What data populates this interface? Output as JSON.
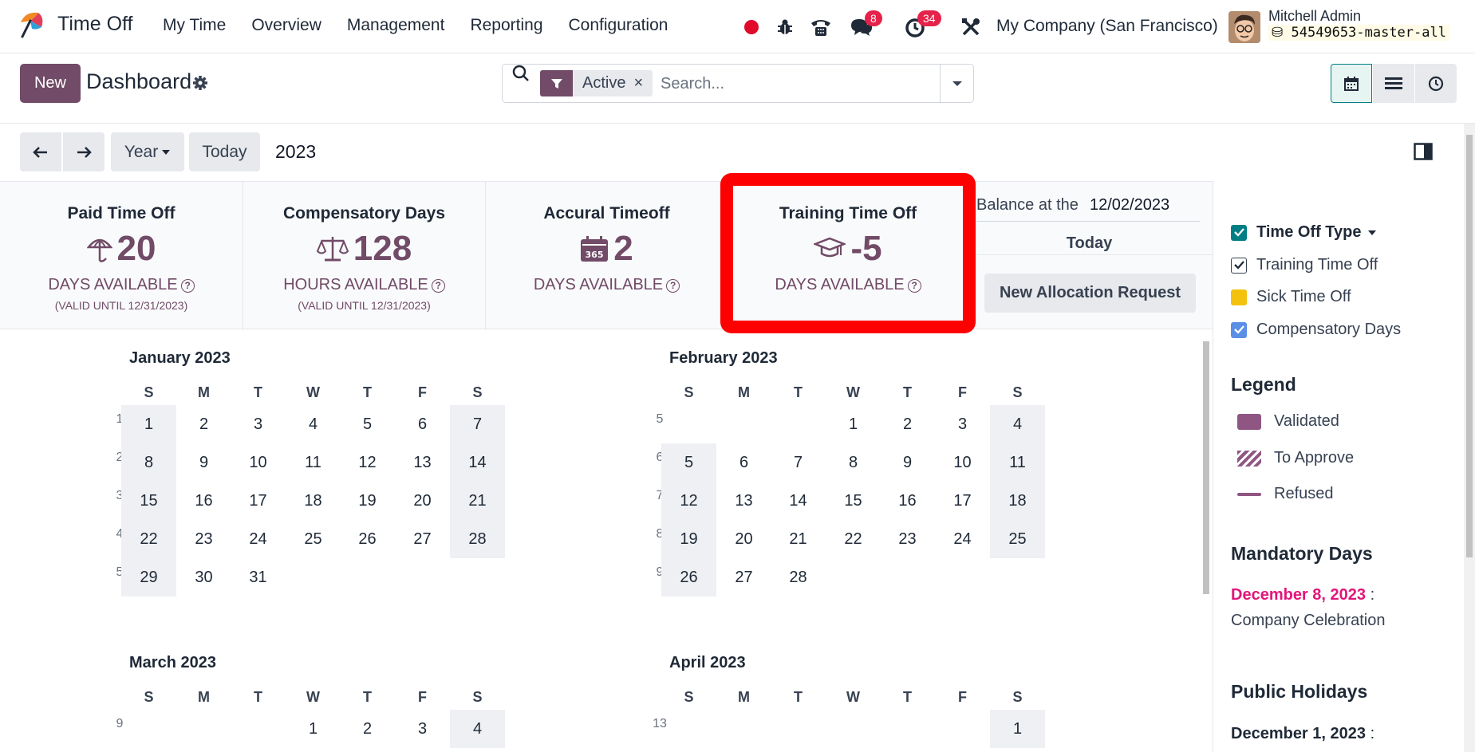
{
  "app": {
    "name": "Time Off",
    "menu": [
      "My Time",
      "Overview",
      "Management",
      "Reporting",
      "Configuration"
    ],
    "messages_count": "8",
    "activities_count": "34",
    "company": "My Company (San Francisco)",
    "user_name": "Mitchell Admin",
    "db_name": "54549653-master-all"
  },
  "control_panel": {
    "new_label": "New",
    "title": "Dashboard",
    "facet_label": "Active",
    "facet_remove": "×",
    "search_placeholder": "Search..."
  },
  "toolbar": {
    "scale_label": "Year",
    "today_label": "Today",
    "current_period": "2023"
  },
  "summary": {
    "cards": [
      {
        "title": "Paid Time Off",
        "value": "20",
        "unit": "DAYS AVAILABLE",
        "valid": "(VALID UNTIL 12/31/2023)",
        "icon": "beach-umbrella-icon"
      },
      {
        "title": "Compensatory Days",
        "value": "128",
        "unit": "HOURS AVAILABLE",
        "valid": "(VALID UNTIL 12/31/2023)",
        "icon": "balance-scale-icon"
      },
      {
        "title": "Accural Timeoff",
        "value": "2",
        "unit": "DAYS AVAILABLE",
        "valid": "",
        "icon": "calendar-365-icon"
      },
      {
        "title": "Training Time Off",
        "value": "-5",
        "unit": "DAYS AVAILABLE",
        "valid": "",
        "icon": "graduation-cap-icon"
      }
    ],
    "help_glyph": "?",
    "balance_label": "Balance at the",
    "balance_date": "12/02/2023",
    "balance_mode": "Today",
    "allocation_button": "New Allocation Request",
    "highlight_color": "#ff0000"
  },
  "calendar": {
    "weekdays": [
      "S",
      "M",
      "T",
      "W",
      "T",
      "F",
      "S"
    ],
    "months": [
      {
        "title": "January 2023",
        "weeks": [
          {
            "wk": "1",
            "days": [
              "1",
              "2",
              "3",
              "4",
              "5",
              "6",
              "7"
            ]
          },
          {
            "wk": "2",
            "days": [
              "8",
              "9",
              "10",
              "11",
              "12",
              "13",
              "14"
            ]
          },
          {
            "wk": "3",
            "days": [
              "15",
              "16",
              "17",
              "18",
              "19",
              "20",
              "21"
            ]
          },
          {
            "wk": "4",
            "days": [
              "22",
              "23",
              "24",
              "25",
              "26",
              "27",
              "28"
            ]
          },
          {
            "wk": "5",
            "days": [
              "29",
              "30",
              "31",
              "",
              "",
              "",
              ""
            ]
          }
        ]
      },
      {
        "title": "February 2023",
        "weeks": [
          {
            "wk": "5",
            "days": [
              "",
              "",
              "",
              "1",
              "2",
              "3",
              "4"
            ]
          },
          {
            "wk": "6",
            "days": [
              "5",
              "6",
              "7",
              "8",
              "9",
              "10",
              "11"
            ]
          },
          {
            "wk": "7",
            "days": [
              "12",
              "13",
              "14",
              "15",
              "16",
              "17",
              "18"
            ]
          },
          {
            "wk": "8",
            "days": [
              "19",
              "20",
              "21",
              "22",
              "23",
              "24",
              "25"
            ]
          },
          {
            "wk": "9",
            "days": [
              "26",
              "27",
              "28",
              "",
              "",
              "",
              ""
            ]
          }
        ]
      },
      {
        "title": "March 2023",
        "weeks": [
          {
            "wk": "9",
            "days": [
              "",
              "",
              "",
              "1",
              "2",
              "3",
              "4"
            ]
          }
        ]
      },
      {
        "title": "April 2023",
        "weeks": [
          {
            "wk": "13",
            "days": [
              "",
              "",
              "",
              "",
              "",
              "",
              "1"
            ]
          }
        ]
      }
    ]
  },
  "sidebar": {
    "filter_title": "Time Off Type",
    "filters": [
      {
        "label": "Training Time Off",
        "color": "#ffffff",
        "checked": true
      },
      {
        "label": "Sick Time Off",
        "color": "#f4c20d",
        "checked": false
      },
      {
        "label": "Compensatory Days",
        "color": "#5b8ee6",
        "checked": true
      }
    ],
    "legend_title": "Legend",
    "legend": [
      {
        "label": "Validated",
        "style": "solid"
      },
      {
        "label": "To Approve",
        "style": "hatched"
      },
      {
        "label": "Refused",
        "style": "line"
      }
    ],
    "mandatory_title": "Mandatory Days",
    "mandatory_date": "December 8, 2023",
    "mandatory_sep": ":",
    "mandatory_name": "Company Celebration",
    "public_title": "Public Holidays",
    "public_date": "December 1, 2023",
    "public_sep": ":"
  },
  "colors": {
    "brand": "#714b67",
    "accent": "#017e84",
    "badge": "#e5224a",
    "mandatory": "#e2157b"
  }
}
